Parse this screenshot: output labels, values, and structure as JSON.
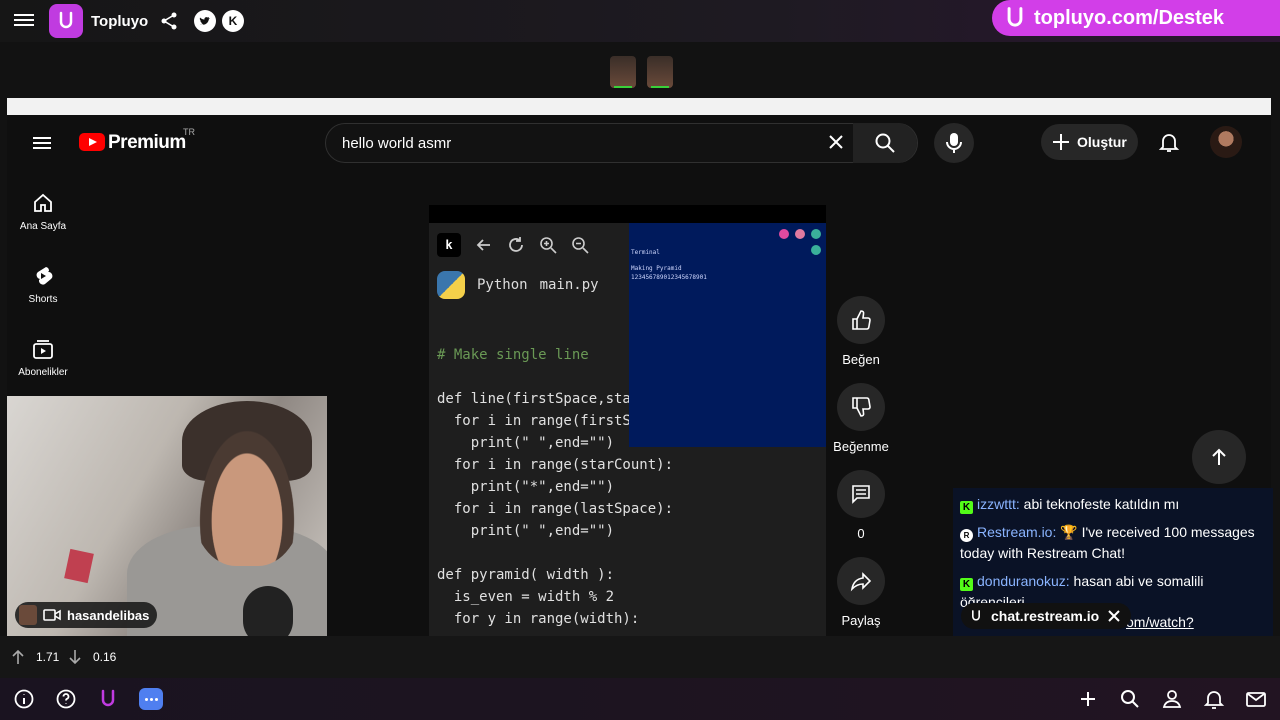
{
  "topbar": {
    "title": "Topluyo",
    "banner_text": "topluyo.com/Destek",
    "social": [
      "twitter-icon",
      "kick-icon"
    ]
  },
  "youtube": {
    "brand": "Premium",
    "region": "TR",
    "search_value": "hello world asmr",
    "create_label": "Oluştur",
    "sidebar": [
      {
        "label": "Ana Sayfa",
        "icon": "home-icon"
      },
      {
        "label": "Shorts",
        "icon": "shorts-icon"
      },
      {
        "label": "Abonelikler",
        "icon": "subscriptions-icon"
      }
    ],
    "actions": {
      "like_label": "Beğen",
      "dislike_label": "Beğenme",
      "comment_count": "0",
      "share_label": "Paylaş"
    }
  },
  "video": {
    "tabs": [
      "Python",
      "main.py"
    ],
    "terminal": {
      "title": "Terminal",
      "lines": [
        "Making Pyramid",
        "123456789012345678901"
      ]
    },
    "code": [
      "# Make single line",
      "",
      "def line(firstSpace,sta",
      "  for i in range(firstS",
      "    print(\" \",end=\"\")",
      "  for i in range(starCount):",
      "    print(\"*\",end=\"\")",
      "  for i in range(lastSpace):",
      "    print(\" \",end=\"\")",
      "",
      "def pyramid( width ):",
      "  is_even = width % 2",
      "  for y in range(width):"
    ]
  },
  "webcam": {
    "username": "hasandelibas"
  },
  "chat": {
    "messages": [
      {
        "platform": "kick",
        "user": "izzwttt:",
        "text": "abi teknofeste katıldın mı"
      },
      {
        "platform": "restream",
        "user": "Restream.io:",
        "text": "🏆 I've received 100 messages today with Restream Chat!"
      },
      {
        "platform": "kick",
        "user": "donduranokuz:",
        "text": "hasan abi ve somalili öğrencileri"
      }
    ],
    "pill_label": "chat.restream.io",
    "link_text": "om/watch?"
  },
  "stats": {
    "up_value": "1.71",
    "down_value": "0.16"
  },
  "colors": {
    "accent": "#d23ee8",
    "youtube_red": "#ff0000",
    "kick_green": "#53fc18"
  }
}
